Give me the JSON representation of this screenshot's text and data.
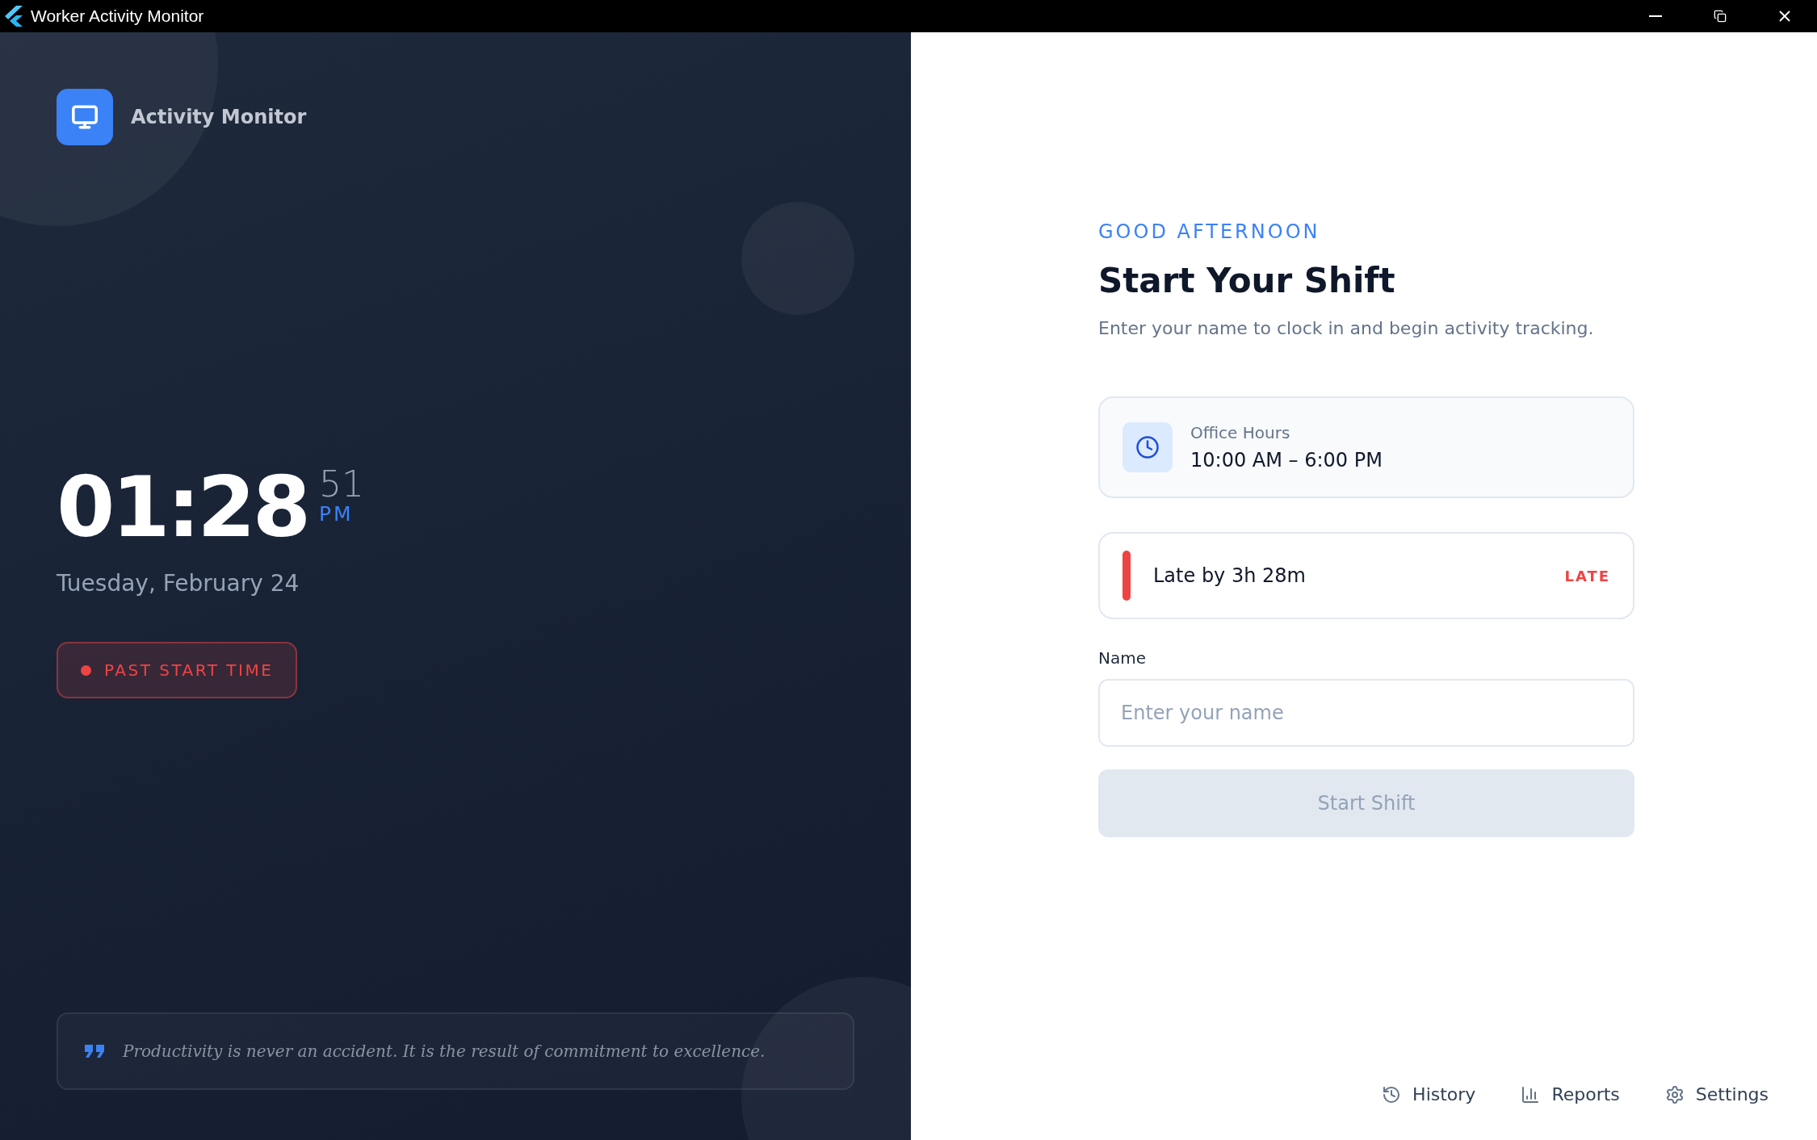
{
  "window": {
    "title": "Worker Activity Monitor"
  },
  "brand": {
    "name": "Activity Monitor"
  },
  "clock": {
    "time": "01:28",
    "seconds": "51",
    "period": "PM"
  },
  "date": "Tuesday, February 24",
  "status_badge": {
    "text": "PAST START TIME"
  },
  "quote": "Productivity is never an accident. It is the result of commitment to excellence.",
  "greeting": "GOOD AFTERNOON",
  "title": "Start Your Shift",
  "subtitle": "Enter your name to clock in and begin activity tracking.",
  "office_hours": {
    "label": "Office Hours",
    "value": "10:00 AM – 6:00 PM"
  },
  "late_notice": {
    "text": "Late by 3h 28m",
    "badge": "LATE",
    "color": "#ef4444"
  },
  "name_field": {
    "label": "Name",
    "placeholder": "Enter your name"
  },
  "start_button": {
    "label": "Start Shift",
    "disabled": true
  },
  "footer_links": [
    {
      "kind": "history",
      "label": "History"
    },
    {
      "kind": "reports",
      "label": "Reports"
    },
    {
      "kind": "settings",
      "label": "Settings"
    }
  ]
}
